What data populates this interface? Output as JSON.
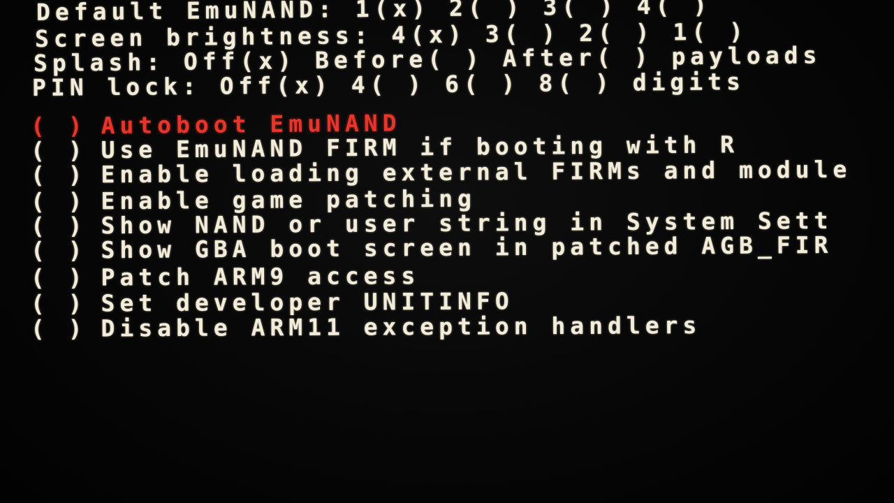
{
  "colors": {
    "background": "#050505",
    "text": "#f2ecd9",
    "selected": "#e8352b"
  },
  "settings": {
    "default_emunand": "Default EmuNAND: 1(x) 2( ) 3( ) 4( )",
    "screen_brightness": "Screen brightness: 4(x) 3( ) 2( ) 1( )",
    "splash": "Splash: Off(x) Before( ) After( ) payloads",
    "pin_lock": "PIN lock: Off(x) 4( ) 6( ) 8( ) digits"
  },
  "toggles": [
    {
      "box": "( )",
      "label": "Autoboot EmuNAND"
    },
    {
      "box": "( )",
      "label": "Use EmuNAND FIRM if booting with R"
    },
    {
      "box": "( )",
      "label": "Enable loading external FIRMs and module"
    },
    {
      "box": "( )",
      "label": "Enable game patching"
    },
    {
      "box": "( )",
      "label": "Show NAND or user string in System Sett"
    },
    {
      "box": "( )",
      "label": "Show GBA boot screen in patched AGB_FIR"
    },
    {
      "box": "( )",
      "label": "Patch ARM9 access"
    },
    {
      "box": "( )",
      "label": "Set developer UNITINFO"
    },
    {
      "box": "( )",
      "label": "Disable ARM11 exception handlers"
    }
  ]
}
